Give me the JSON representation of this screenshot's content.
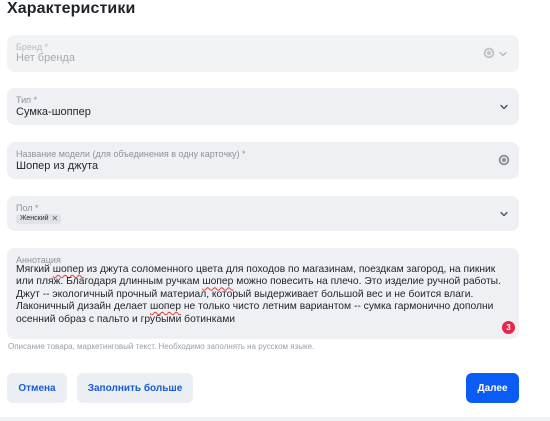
{
  "section": {
    "title": "Характеристики"
  },
  "brand": {
    "label": "Бренд *",
    "value": "Нет бренда"
  },
  "type": {
    "label": "Тип *",
    "value": "Сумка-шоппер"
  },
  "model": {
    "label": "Название модели (для объединения в одну карточку) *",
    "value": "Шопер из джута"
  },
  "gender": {
    "label": "Пол *",
    "tags": [
      "Женский"
    ]
  },
  "annotation": {
    "label": "Аннотация",
    "lines": [
      [
        "Мягкий ",
        "шопер",
        " из джута соломенного цвета для походов по магазинам, поездкам загород, на пикник"
      ],
      [
        "или пляж. Благодаря длинным ручкам ",
        "шопер",
        " можно повесить на плечо. Это изделие ручной работы."
      ],
      [
        "Джут -- экологичный прочный материал, который выдерживает большой вес и не боится влаги."
      ],
      [
        "Лаконичный дизайн делает ",
        "шопер",
        " не только чисто летним вариантом -- сумка гармонично дополни"
      ],
      [
        "осенний образ с пальто и грубыми ботинками"
      ]
    ],
    "error_count": "3",
    "hint": "Описание товара, маркетинговый текст. Необходимо заполнять на русском языке."
  },
  "actions": {
    "cancel": "Отмена",
    "fill_more": "Заполнить больше",
    "next": "Далее"
  },
  "colors": {
    "accent": "#0a5cf5",
    "field_bg": "#eef0f3",
    "error": "#e8254b"
  }
}
